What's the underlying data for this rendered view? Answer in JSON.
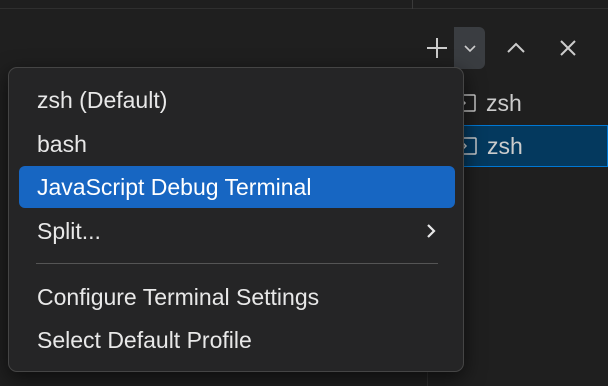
{
  "colors": {
    "background": "#1f1f1f",
    "menu_background": "#252526",
    "menu_selected": "#1766c2",
    "terminal_selected": "#04395e",
    "terminal_selected_border": "#0078d4",
    "text": "#e8e8e8"
  },
  "toolbar": {
    "new_terminal_icon": "plus-icon",
    "profile_dropdown_icon": "chevron-down-icon",
    "maximize_icon": "chevron-up-icon",
    "close_icon": "close-icon"
  },
  "terminals": [
    {
      "label": "zsh",
      "icon": "terminal-icon",
      "selected": false
    },
    {
      "label": "zsh",
      "icon": "terminal-icon",
      "selected": true
    }
  ],
  "menu": {
    "items": [
      {
        "label": "zsh (Default)"
      },
      {
        "label": "bash"
      },
      {
        "label": "JavaScript Debug Terminal",
        "selected": true
      },
      {
        "label": "Split...",
        "submenu_icon": "chevron-right-icon"
      },
      {
        "label": "Configure Terminal Settings"
      },
      {
        "label": "Select Default Profile"
      }
    ]
  }
}
